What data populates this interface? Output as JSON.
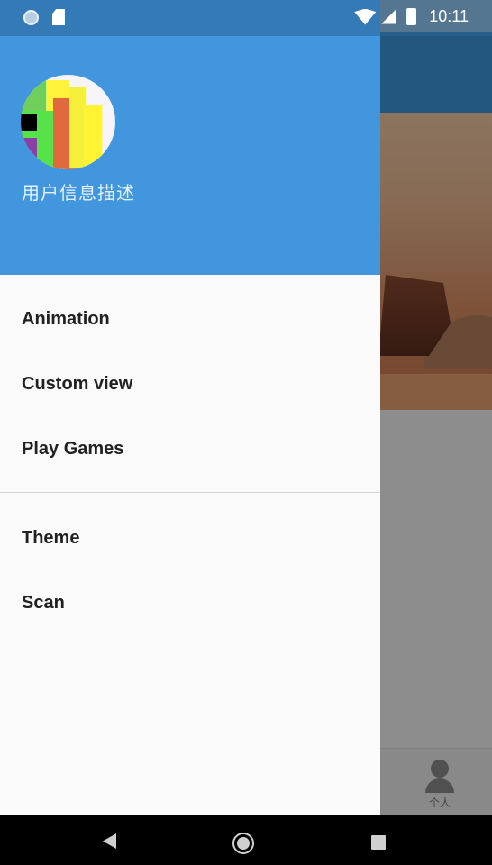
{
  "status_bar": {
    "time": "10:11",
    "icons_left": [
      "sync-circle-icon",
      "sd-card-icon"
    ],
    "icons_right": [
      "wifi-icon",
      "cell-signal-icon",
      "battery-icon"
    ]
  },
  "drawer": {
    "header": {
      "description": "用户信息描述",
      "background_color": "#4196de"
    },
    "menu_group_1": [
      "Animation",
      "Custom view",
      "Play Games"
    ],
    "menu_group_2": [
      "Theme",
      "Scan"
    ]
  },
  "app": {
    "bottom_nav": {
      "profile_label": "个人"
    }
  },
  "system_nav": {
    "icons": [
      "back-icon",
      "home-icon",
      "recents-icon"
    ]
  }
}
